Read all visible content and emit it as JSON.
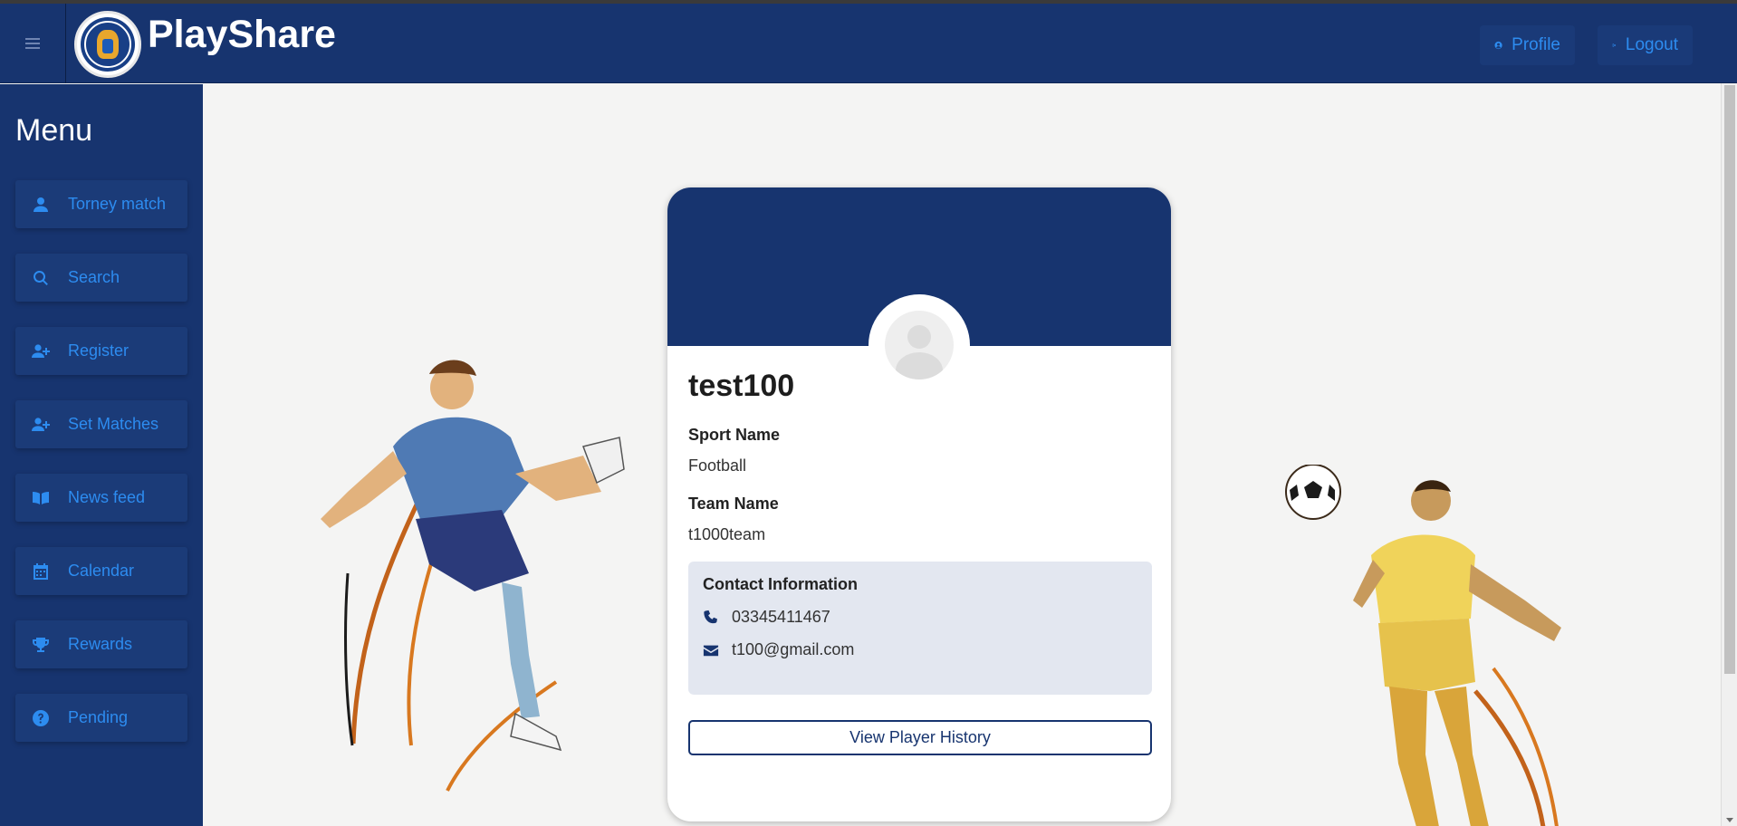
{
  "app": {
    "brand": "PlayShare",
    "colors": {
      "primary": "#17346f",
      "accent": "#2d8cf0",
      "background": "#f4f4f3"
    }
  },
  "navbar": {
    "menu_toggle_icon": "hamburger-icon",
    "profile_label": "Profile",
    "profile_icon": "user-circle-icon",
    "logout_label": "Logout",
    "logout_icon": "sign-out-icon"
  },
  "sidebar": {
    "title": "Menu",
    "items": [
      {
        "label": "Torney match",
        "icon": "user-icon"
      },
      {
        "label": "Search",
        "icon": "search-icon"
      },
      {
        "label": "Register",
        "icon": "user-plus-icon"
      },
      {
        "label": "Set Matches",
        "icon": "user-plus-icon"
      },
      {
        "label": "News feed",
        "icon": "book-open-icon"
      },
      {
        "label": "Calendar",
        "icon": "calendar-icon"
      },
      {
        "label": "Rewards",
        "icon": "trophy-icon"
      },
      {
        "label": "Pending",
        "icon": "question-circle-icon"
      }
    ]
  },
  "profile": {
    "username": "test100",
    "sport_label": "Sport Name",
    "sport_value": "Football",
    "team_label": "Team Name",
    "team_value": "t1000team",
    "contact_title": "Contact Information",
    "phone": "03345411467",
    "email": "t100@gmail.com",
    "history_button": "View Player History"
  }
}
